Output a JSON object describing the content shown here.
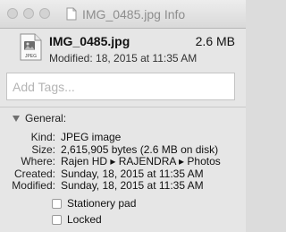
{
  "window": {
    "title": "IMG_0485.jpg Info"
  },
  "header": {
    "filename": "IMG_0485.jpg",
    "size": "2.6 MB",
    "modified": "Modified:  18, 2015  at 11:35 AM",
    "icon_label": "JPEG"
  },
  "tags": {
    "placeholder": "Add Tags..."
  },
  "general": {
    "section_label": "General:",
    "rows": [
      {
        "key": "Kind:",
        "value": "JPEG image"
      },
      {
        "key": "Size:",
        "value": "2,615,905 bytes (2.6 MB on disk)"
      },
      {
        "key": "Where:",
        "value": "Rajen HD ▸ RAJENDRA ▸ Photos"
      },
      {
        "key": "Created:",
        "value": "Sunday, 18, 2015  at 11:35 AM"
      },
      {
        "key": "Modified:",
        "value": "Sunday, 18, 2015  at 11:35 AM"
      }
    ],
    "checkboxes": [
      {
        "label": "Stationery pad",
        "checked": false
      },
      {
        "label": "Locked",
        "checked": false
      }
    ]
  },
  "colors": {
    "window_bg": "#e6e6e6",
    "titlebar_text": "#8e8e8e"
  }
}
